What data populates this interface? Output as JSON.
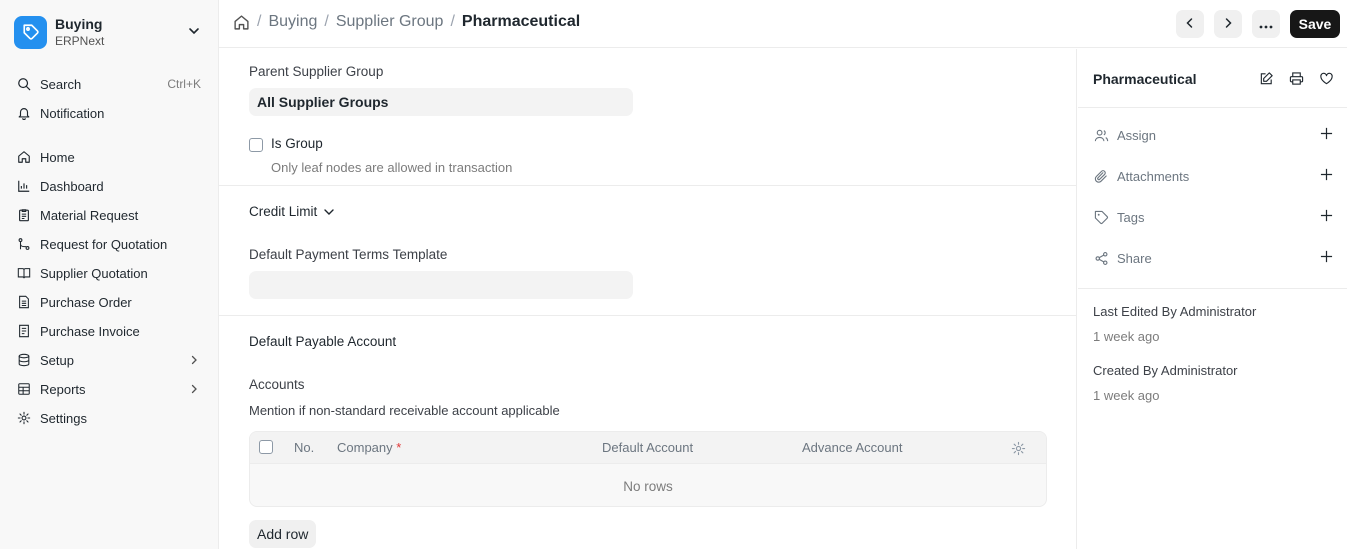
{
  "app": {
    "name": "Buying",
    "sub": "ERPNext"
  },
  "sidebar": {
    "search": {
      "label": "Search",
      "shortcut": "Ctrl+K"
    },
    "notification": "Notification",
    "items": [
      {
        "label": "Home",
        "icon": "home-icon"
      },
      {
        "label": "Dashboard",
        "icon": "bar-chart-icon"
      },
      {
        "label": "Material Request",
        "icon": "clipboard-icon"
      },
      {
        "label": "Request for Quotation",
        "icon": "branch-icon"
      },
      {
        "label": "Supplier Quotation",
        "icon": "book-open-icon"
      },
      {
        "label": "Purchase Order",
        "icon": "file-text-icon"
      },
      {
        "label": "Purchase Invoice",
        "icon": "receipt-icon"
      },
      {
        "label": "Setup",
        "icon": "database-icon"
      },
      {
        "label": "Reports",
        "icon": "table-icon"
      },
      {
        "label": "Settings",
        "icon": "gear-icon"
      }
    ]
  },
  "header": {
    "breadcrumb": [
      "Buying",
      "Supplier Group"
    ],
    "current": "Pharmaceutical",
    "save_label": "Save"
  },
  "form": {
    "parent_label": "Parent Supplier Group",
    "parent_value": "All Supplier Groups",
    "is_group_label": "Is Group",
    "is_group_help": "Only leaf nodes are allowed in transaction",
    "credit_limit_label": "Credit Limit",
    "payment_terms_label": "Default Payment Terms Template",
    "payment_terms_value": "",
    "payable_section": "Default Payable Account",
    "accounts_label": "Accounts",
    "accounts_help": "Mention if non-standard receivable account applicable",
    "grid": {
      "columns": [
        "No.",
        "Company",
        "Default Account",
        "Advance Account"
      ],
      "required_mark": "*",
      "empty": "No rows"
    },
    "add_row_label": "Add row"
  },
  "right": {
    "title": "Pharmaceutical",
    "actions": [
      {
        "label": "Assign",
        "icon": "users-icon"
      },
      {
        "label": "Attachments",
        "icon": "paperclip-icon"
      },
      {
        "label": "Tags",
        "icon": "tag-icon"
      },
      {
        "label": "Share",
        "icon": "share-icon"
      }
    ],
    "last_edited": "Last Edited By Administrator",
    "last_edited_time": "1 week ago",
    "created": "Created By Administrator",
    "created_time": "1 week ago"
  }
}
